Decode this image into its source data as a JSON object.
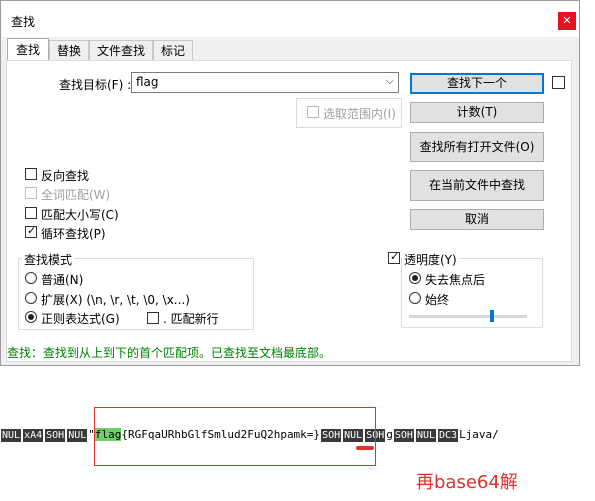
{
  "dialog": {
    "title": "查找",
    "close_glyph": "✕",
    "tabs": [
      "查找",
      "替换",
      "文件查找",
      "标记"
    ],
    "find_label": "查找目标(F) :",
    "find_value": "flag",
    "selection_only": "选取范围内(I)",
    "buttons": {
      "find_next": "查找下一个",
      "count": "计数(T)",
      "find_all_open": "查找所有打开文件(O)",
      "find_in_current": "在当前文件中查找",
      "cancel": "取消"
    },
    "options": {
      "reverse": "反向查找",
      "whole_word": "全词匹配(W)",
      "match_case": "匹配大小写(C)",
      "wrap": "循环查找(P)"
    },
    "search_mode": {
      "title": "查找模式",
      "normal": "普通(N)",
      "extended": "扩展(X) (\\n, \\r, \\t, \\0, \\x...)",
      "regex": "正则表达式(G)",
      "dot_newline": ". 匹配新行"
    },
    "transparency": {
      "title": "透明度(Y)",
      "on_lose_focus": "失去焦点后",
      "always": "始终",
      "level": 0.7
    },
    "status": "查找：查找到从上到下的首个匹配项。已查找至文档最底部。"
  },
  "hex": {
    "prefix_ctl": [
      "NUL",
      "xA4",
      "SOH",
      "NUL"
    ],
    "quote": "\"",
    "flag": "flag",
    "payload": "{RGFqaURhbGlfSmlud2FuQ2hpamk=}",
    "suffix": [
      {
        "ctl": "SOH"
      },
      {
        "ctl": "NUL"
      },
      {
        "ctl": "SOH"
      },
      {
        "text": "g"
      },
      {
        "ctl": "SOH"
      },
      {
        "ctl": "NUL"
      },
      {
        "ctl": "DC3"
      },
      {
        "text": "Ljava/"
      }
    ]
  },
  "annotation": "再base64解",
  "colors": {
    "highlight": "#6fcf6f",
    "annotation": "#e03030",
    "status": "#008000"
  }
}
